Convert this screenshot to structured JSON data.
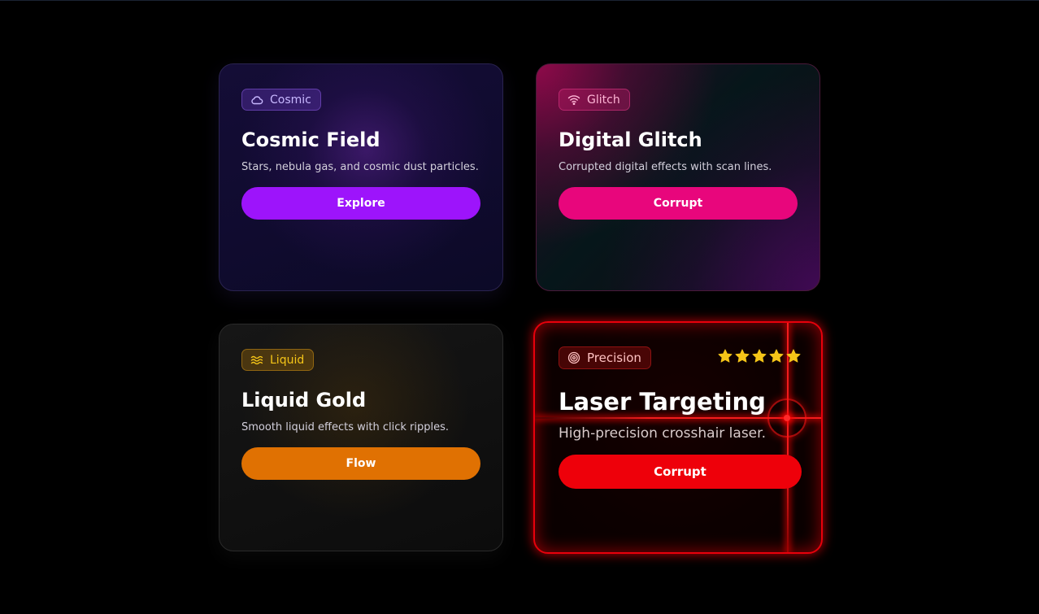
{
  "colors": {
    "background": "#000000",
    "cosmic_accent": "#9d14fb",
    "glitch_accent": "#e8067c",
    "liquid_accent": "#e07102",
    "laser_accent": "#ee000a",
    "star_color": "#f5c518"
  },
  "cards": [
    {
      "badge": "Cosmic",
      "badge_icon": "cloud-icon",
      "title": "Cosmic Field",
      "description": "Stars, nebula gas, and cosmic dust particles.",
      "button": "Explore"
    },
    {
      "badge": "Glitch",
      "badge_icon": "wifi-icon",
      "title": "Digital Glitch",
      "description": "Corrupted digital effects with scan lines.",
      "button": "Corrupt"
    },
    {
      "badge": "Liquid",
      "badge_icon": "waves-icon",
      "title": "Liquid Gold",
      "description": "Smooth liquid effects with click ripples.",
      "button": "Flow"
    },
    {
      "badge": "Precision",
      "badge_icon": "target-icon",
      "title": "Laser Targeting",
      "description": "High-precision crosshair laser.",
      "button": "Corrupt",
      "rating": 5,
      "rating_max": 5
    }
  ]
}
